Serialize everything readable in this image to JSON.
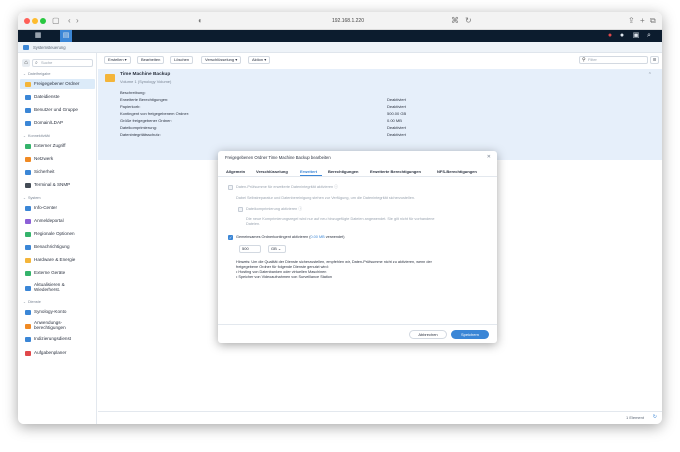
{
  "browser": {
    "url": "192.168.1.220",
    "colors": {
      "red": "#ff5f57",
      "yellow": "#febc2e",
      "green": "#28c840"
    }
  },
  "app": {
    "title": "Systemsteuerung"
  },
  "sidebar": {
    "search_placeholder": "Suche",
    "sections": [
      {
        "label": "Dateifreigabe"
      },
      {
        "label": "Konnektivität"
      },
      {
        "label": "System"
      },
      {
        "label": "Dienste"
      }
    ],
    "items": [
      {
        "label": "Freigegebener Ordner",
        "icon": "folder-icon",
        "color": "#f4b53a"
      },
      {
        "label": "Dateidienste",
        "icon": "file-services-icon",
        "color": "#3b86d6"
      },
      {
        "label": "Benutzer und Gruppe",
        "icon": "users-icon",
        "color": "#3b86d6"
      },
      {
        "label": "Domain/LDAP",
        "icon": "domain-icon",
        "color": "#3b86d6"
      },
      {
        "label": "Externer Zugriff",
        "icon": "external-access-icon",
        "color": "#34b36b"
      },
      {
        "label": "Netzwerk",
        "icon": "network-icon",
        "color": "#f08a24"
      },
      {
        "label": "Sicherheit",
        "icon": "shield-icon",
        "color": "#3b86d6"
      },
      {
        "label": "Terminal & SNMP",
        "icon": "terminal-icon",
        "color": "#444c56"
      },
      {
        "label": "Info-Center",
        "icon": "info-icon",
        "color": "#3b86d6"
      },
      {
        "label": "Anmeldeportal",
        "icon": "login-portal-icon",
        "color": "#8c5fd6"
      },
      {
        "label": "Regionale Optionen",
        "icon": "globe-icon",
        "color": "#34b36b"
      },
      {
        "label": "Benachrichtigung",
        "icon": "notification-icon",
        "color": "#3b86d6"
      },
      {
        "label": "Hardware & Energie",
        "icon": "hardware-icon",
        "color": "#f4b53a"
      },
      {
        "label": "Externe Geräte",
        "icon": "external-devices-icon",
        "color": "#34b36b"
      },
      {
        "label_1": "Aktualisieren &",
        "label_2": "Wiederherst.",
        "icon": "update-icon",
        "color": "#3b86d6"
      },
      {
        "label": "Synology-Konto",
        "icon": "synology-account-icon",
        "color": "#3b86d6"
      },
      {
        "label_1": "Anwendungs-",
        "label_2": "berechtigungen",
        "icon": "app-permissions-icon",
        "color": "#f08a24"
      },
      {
        "label": "Indizierungsdienst",
        "icon": "indexing-icon",
        "color": "#3b86d6"
      },
      {
        "label": "Aufgabenplaner",
        "icon": "calendar-icon",
        "color": "#e0484a"
      }
    ]
  },
  "toolbar": {
    "create": "Erstellen ▾",
    "edit": "Bearbeiten",
    "delete": "Löschen",
    "encryption": "Verschlüsselung ▾",
    "action": "Aktion ▾",
    "filter_placeholder": "Filter"
  },
  "folder": {
    "name": "Time Machine Backup",
    "location": "Volume 1 (Synology Volume)",
    "rows": [
      {
        "label": "Beschreibung:",
        "value": ""
      },
      {
        "label": "Erweiterte Berechtigungen:",
        "value": "Deaktiviert"
      },
      {
        "label": "Papierkorb:",
        "value": "Deaktiviert"
      },
      {
        "label": "Kontingent von freigegebenem Ordner:",
        "value": "500.00 GB"
      },
      {
        "label": "Größe freigegebener Ordner:",
        "value": "0.00 MB"
      },
      {
        "label": "Dateikomprimierung:",
        "value": "Deaktiviert"
      },
      {
        "label": "Datenintegritätsschutz:",
        "value": "Deaktiviert"
      }
    ]
  },
  "footer": {
    "count": "1 Element"
  },
  "dialog": {
    "title": "Freigegebenen Ordner Time Machine Backup bearbeiten",
    "tabs": [
      "Allgemein",
      "Verschlüsselung",
      "Erweitert",
      "Berechtigungen",
      "Erweiterte Berechtigungen",
      "NFS-Berechtigungen"
    ],
    "active_tab": "Erweitert",
    "checksum_label": "Daten-Prüfsumme für erweiterte Datenintegrität aktivieren",
    "checksum_desc": "Dabei Selbstreparatur und Datenbereinigung stehen zur Verfügung, um die Datenintegrität sicherzustellen.",
    "compression_label": "Dateikomprimierung aktivieren",
    "compression_desc_1": "Die neue Komprimierungsregel wird nur auf neu hinzugefügte Dateien angewendet. Sie gilt nicht für vorhandene",
    "compression_desc_2": "Dateien.",
    "quota_label": "Gemeinsames Ordnerkontingent aktivieren (",
    "quota_used": "0.00 MB",
    "quota_label_end": " verwendet)",
    "quota_value": "500",
    "quota_unit": "GB",
    "note_1": "Hinweis: Um die Qualität der Dienste sicherzustellen, empfehlen wir, Daten-Prüfsumme nicht zu aktivieren, wenn der",
    "note_2": "freigegebene Ordner für folgende Dienste genutzt wird:",
    "note_3": "• Hosting von Datenbanken oder virtuellen Maschinen",
    "note_4": "• Speicher von Videoaufnahmen von Surveillance Station",
    "cancel": "Abbrechen",
    "save": "Speichern"
  }
}
